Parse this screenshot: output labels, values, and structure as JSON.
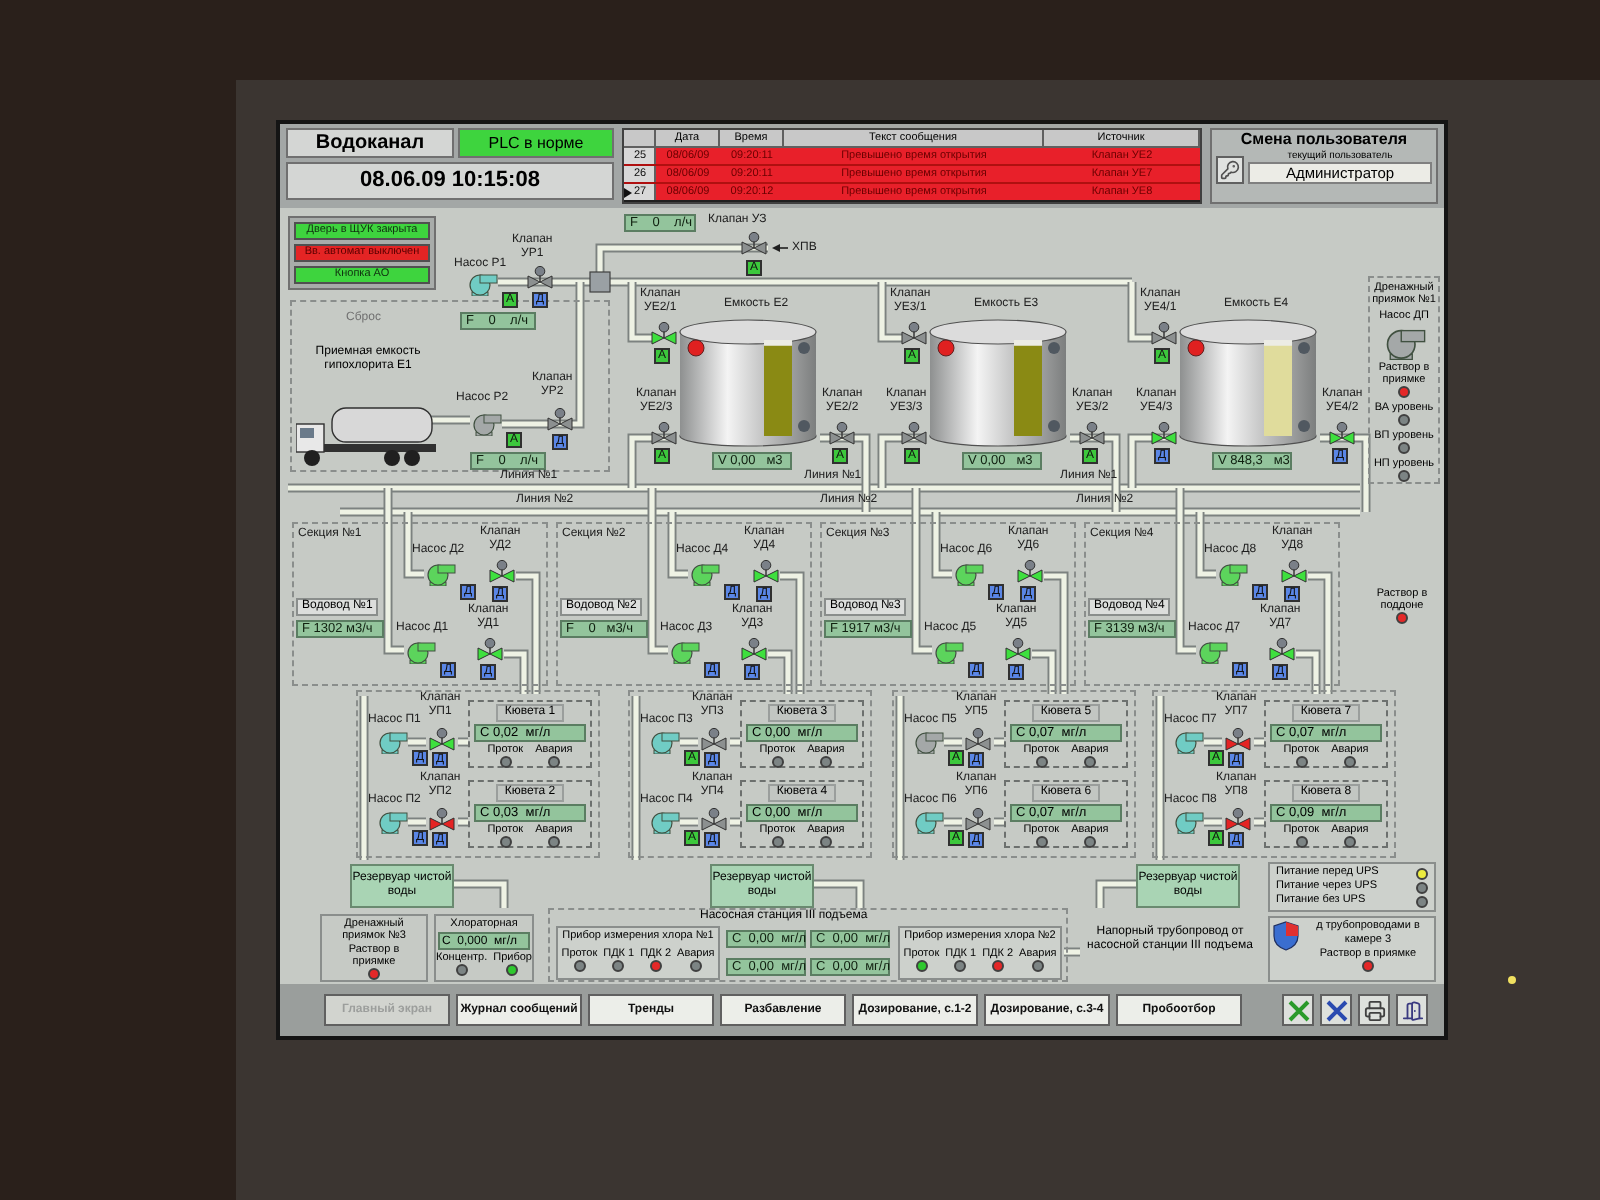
{
  "header": {
    "title": "Водоканал",
    "plc": {
      "text": "PLC в норме",
      "ok": true
    },
    "datetime": "08.06.09 10:15:08"
  },
  "alarms": {
    "columns": [
      "Дата",
      "Время",
      "Текст сообщения",
      "Источник"
    ],
    "rows": [
      {
        "num": "25",
        "date": "08/06/09",
        "time": "09:20:11",
        "text": "Превышено время открытия",
        "source": "Клапан УЕ2",
        "selected": false
      },
      {
        "num": "26",
        "date": "08/06/09",
        "time": "09:20:11",
        "text": "Превышено время открытия",
        "source": "Клапан УЕ7",
        "selected": false
      },
      {
        "num": "27",
        "date": "08/06/09",
        "time": "09:20:12",
        "text": "Превышено время открытия",
        "source": "Клапан УЕ8",
        "selected": true
      }
    ]
  },
  "user": {
    "title": "Смена пользователя",
    "caption": "текущий пользователь",
    "name": "Администратор"
  },
  "status_indicators": [
    {
      "text": "Дверь в ЩУК закрыта",
      "alarm": false
    },
    {
      "text": "Вв. автомат выключен",
      "alarm": true
    },
    {
      "text": "Кнопка АО",
      "alarm": false
    }
  ],
  "intake": {
    "reset": "Сброс",
    "tank_label": "Приемная емкость гипохлорита Е1",
    "supply_flow": "F    0    л/ч",
    "inlet": "ХПВ",
    "supply_valve": {
      "label": "Клапан",
      "tag": "УЗ",
      "color": "#8c9090",
      "badge": {
        "text": "А",
        "kind": "auto"
      }
    },
    "pumps": [
      {
        "label": "Насос Р1",
        "color": "#70ccc4",
        "badge": {
          "text": "А",
          "kind": "auto"
        },
        "flow": "F    0    л/ч"
      },
      {
        "label": "Насос Р2",
        "color": "#a4a8a8",
        "badge": {
          "text": "А",
          "kind": "auto"
        },
        "flow": "F    0    л/ч"
      }
    ],
    "valves": [
      {
        "label": "Клапан",
        "tag": "УР1",
        "color": "#8c9090",
        "badge": {
          "text": "Д",
          "kind": "remote"
        }
      },
      {
        "label": "Клапан",
        "tag": "УР2",
        "color": "#8c9090",
        "badge": {
          "text": "Д",
          "kind": "remote"
        }
      }
    ]
  },
  "tanks": [
    {
      "label": "Емкость Е2",
      "level": 0.94,
      "color": "#8a8a14",
      "volume": "V 0,00   м3",
      "valves": [
        {
          "label": "Клапан",
          "tag": "УЕ2/1",
          "color": "#3ee03e",
          "badge": {
            "text": "А",
            "kind": "auto"
          }
        },
        {
          "label": "Клапан",
          "tag": "УЕ2/3",
          "color": "#8c9090",
          "badge": {
            "text": "А",
            "kind": "auto"
          }
        },
        {
          "label": "Клапан",
          "tag": "УЕ2/2",
          "color": "#8c9090",
          "badge": {
            "text": "А",
            "kind": "auto"
          }
        }
      ]
    },
    {
      "label": "Емкость Е3",
      "level": 0.94,
      "color": "#8a8a14",
      "volume": "V 0,00   м3",
      "valves": [
        {
          "label": "Клапан",
          "tag": "УЕ3/1",
          "color": "#8c9090",
          "badge": {
            "text": "А",
            "kind": "auto"
          }
        },
        {
          "label": "Клапан",
          "tag": "УЕ3/3",
          "color": "#8c9090",
          "badge": {
            "text": "А",
            "kind": "auto"
          }
        },
        {
          "label": "Клапан",
          "tag": "УЕ3/2",
          "color": "#8c9090",
          "badge": {
            "text": "А",
            "kind": "auto"
          }
        }
      ]
    },
    {
      "label": "Емкость Е4",
      "level": 0.94,
      "color": "#e0dc9c",
      "volume": "V 848,3   м3",
      "valves": [
        {
          "label": "Клапан",
          "tag": "УЕ4/1",
          "color": "#8c9090",
          "badge": {
            "text": "А",
            "kind": "auto"
          }
        },
        {
          "label": "Клапан",
          "tag": "УЕ4/3",
          "color": "#3ee03e",
          "badge": {
            "text": "Д",
            "kind": "remote"
          }
        },
        {
          "label": "Клапан",
          "tag": "УЕ4/2",
          "color": "#3ee03e",
          "badge": {
            "text": "Д",
            "kind": "remote"
          }
        }
      ]
    }
  ],
  "lines": [
    {
      "text": "Линия №1"
    },
    {
      "text": "Линия №1"
    },
    {
      "text": "Линия №1"
    },
    {
      "text": "Линия №2"
    },
    {
      "text": "Линия №2"
    },
    {
      "text": "Линия №2"
    }
  ],
  "drain_1": {
    "title": "Дренажный приямок №1",
    "pump": {
      "label": "Насос ДП",
      "color": "#a4a8a8"
    },
    "indicators": [
      {
        "text": "Раствор в приямке",
        "color": "#e42828"
      },
      {
        "text": "ВА уровень",
        "color": "#7c8484"
      },
      {
        "text": "ВП уровень",
        "color": "#7c8484"
      },
      {
        "text": "НП уровень",
        "color": "#7c8484"
      }
    ]
  },
  "sections": [
    {
      "title": "Секция №1",
      "conduit": "Водовод №1",
      "flow": "F 1302 м3/ч",
      "pumps": [
        {
          "label": "Насос Д2",
          "color": "#5cd45c",
          "badge": {
            "text": "Д",
            "kind": "remote"
          }
        },
        {
          "label": "Насос Д1",
          "color": "#5cd45c",
          "badge": {
            "text": "Д",
            "kind": "remote"
          }
        }
      ],
      "valves": [
        {
          "label": "Клапан",
          "tag": "УД2",
          "color": "#3ee03e",
          "badge": {
            "text": "Д",
            "kind": "remote"
          }
        },
        {
          "label": "Клапан",
          "tag": "УД1",
          "color": "#3ee03e",
          "badge": {
            "text": "Д",
            "kind": "remote"
          }
        }
      ]
    },
    {
      "title": "Секция №2",
      "conduit": "Водовод №2",
      "flow": "F    0   м3/ч",
      "pumps": [
        {
          "label": "Насос Д4",
          "color": "#5cd45c",
          "badge": {
            "text": "Д",
            "kind": "remote"
          }
        },
        {
          "label": "Насос Д3",
          "color": "#5cd45c",
          "badge": {
            "text": "Д",
            "kind": "remote"
          }
        }
      ],
      "valves": [
        {
          "label": "Клапан",
          "tag": "УД4",
          "color": "#3ee03e",
          "badge": {
            "text": "Д",
            "kind": "remote"
          }
        },
        {
          "label": "Клапан",
          "tag": "УД3",
          "color": "#3ee03e",
          "badge": {
            "text": "Д",
            "kind": "remote"
          }
        }
      ]
    },
    {
      "title": "Секция №3",
      "conduit": "Водовод №3",
      "flow": "F 1917 м3/ч",
      "pumps": [
        {
          "label": "Насос Д6",
          "color": "#5cd45c",
          "badge": {
            "text": "Д",
            "kind": "remote"
          }
        },
        {
          "label": "Насос Д5",
          "color": "#5cd45c",
          "badge": {
            "text": "Д",
            "kind": "remote"
          }
        }
      ],
      "valves": [
        {
          "label": "Клапан",
          "tag": "УД6",
          "color": "#3ee03e",
          "badge": {
            "text": "Д",
            "kind": "remote"
          }
        },
        {
          "label": "Клапан",
          "tag": "УД5",
          "color": "#3ee03e",
          "badge": {
            "text": "Д",
            "kind": "remote"
          }
        }
      ]
    },
    {
      "title": "Секция №4",
      "conduit": "Водовод №4",
      "flow": "F 3139 м3/ч",
      "pumps": [
        {
          "label": "Насос Д8",
          "color": "#5cd45c",
          "badge": {
            "text": "Д",
            "kind": "remote"
          }
        },
        {
          "label": "Насос Д7",
          "color": "#5cd45c",
          "badge": {
            "text": "Д",
            "kind": "remote"
          }
        }
      ],
      "valves": [
        {
          "label": "Клапан",
          "tag": "УД8",
          "color": "#3ee03e",
          "badge": {
            "text": "Д",
            "kind": "remote"
          }
        },
        {
          "label": "Клапан",
          "tag": "УД7",
          "color": "#3ee03e",
          "badge": {
            "text": "Д",
            "kind": "remote"
          }
        }
      ]
    }
  ],
  "tray": {
    "text": "Раствор в поддоне",
    "color": "#e42828"
  },
  "chlorination": [
    {
      "pumps": [
        {
          "label": "Насос П1",
          "color": "#70ccc4",
          "badge": {
            "text": "Д",
            "kind": "remote"
          }
        },
        {
          "label": "Насос П2",
          "color": "#70ccc4",
          "badge": {
            "text": "Д",
            "kind": "remote"
          }
        }
      ],
      "valves": [
        {
          "label": "Клапан",
          "tag": "УП1",
          "color": "#3ee03e",
          "badge": {
            "text": "Д",
            "kind": "remote"
          }
        },
        {
          "label": "Клапан",
          "tag": "УП2",
          "color": "#e42424",
          "badge": {
            "text": "Д",
            "kind": "remote"
          }
        }
      ],
      "cuvettes": [
        {
          "title": "Кювета 1",
          "reading": "С 0,02  мг/л",
          "indicators": [
            {
              "text": "Проток",
              "color": "#7c8484"
            },
            {
              "text": "Авария",
              "color": "#7c8484"
            }
          ]
        },
        {
          "title": "Кювета 2",
          "reading": "С 0,03  мг/л",
          "indicators": [
            {
              "text": "Проток",
              "color": "#7c8484"
            },
            {
              "text": "Авария",
              "color": "#7c8484"
            }
          ]
        }
      ]
    },
    {
      "pumps": [
        {
          "label": "Насос П3",
          "color": "#70ccc4",
          "badge": {
            "text": "А",
            "kind": "auto"
          }
        },
        {
          "label": "Насос П4",
          "color": "#70ccc4",
          "badge": {
            "text": "А",
            "kind": "auto"
          }
        }
      ],
      "valves": [
        {
          "label": "Клапан",
          "tag": "УП3",
          "color": "#8c9090",
          "badge": {
            "text": "Д",
            "kind": "remote"
          }
        },
        {
          "label": "Клапан",
          "tag": "УП4",
          "color": "#8c9090",
          "badge": {
            "text": "Д",
            "kind": "remote"
          }
        }
      ],
      "cuvettes": [
        {
          "title": "Кювета 3",
          "reading": "С 0,00  мг/л",
          "indicators": [
            {
              "text": "Проток",
              "color": "#7c8484"
            },
            {
              "text": "Авария",
              "color": "#7c8484"
            }
          ]
        },
        {
          "title": "Кювета 4",
          "reading": "С 0,00  мг/л",
          "indicators": [
            {
              "text": "Проток",
              "color": "#7c8484"
            },
            {
              "text": "Авария",
              "color": "#7c8484"
            }
          ]
        }
      ]
    },
    {
      "pumps": [
        {
          "label": "Насос П5",
          "color": "#a4a8a8",
          "badge": {
            "text": "А",
            "kind": "auto"
          }
        },
        {
          "label": "Насос П6",
          "color": "#70ccc4",
          "badge": {
            "text": "А",
            "kind": "auto"
          }
        }
      ],
      "valves": [
        {
          "label": "Клапан",
          "tag": "УП5",
          "color": "#8c9090",
          "badge": {
            "text": "Д",
            "kind": "remote"
          }
        },
        {
          "label": "Клапан",
          "tag": "УП6",
          "color": "#8c9090",
          "badge": {
            "text": "Д",
            "kind": "remote"
          }
        }
      ],
      "cuvettes": [
        {
          "title": "Кювета 5",
          "reading": "С 0,07  мг/л",
          "indicators": [
            {
              "text": "Проток",
              "color": "#7c8484"
            },
            {
              "text": "Авария",
              "color": "#7c8484"
            }
          ]
        },
        {
          "title": "Кювета 6",
          "reading": "С 0,07  мг/л",
          "indicators": [
            {
              "text": "Проток",
              "color": "#7c8484"
            },
            {
              "text": "Авария",
              "color": "#7c8484"
            }
          ]
        }
      ]
    },
    {
      "pumps": [
        {
          "label": "Насос П7",
          "color": "#70ccc4",
          "badge": {
            "text": "А",
            "kind": "auto"
          }
        },
        {
          "label": "Насос П8",
          "color": "#70ccc4",
          "badge": {
            "text": "А",
            "kind": "auto"
          }
        }
      ],
      "valves": [
        {
          "label": "Клапан",
          "tag": "УП7",
          "color": "#e42424",
          "badge": {
            "text": "Д",
            "kind": "remote"
          }
        },
        {
          "label": "Клапан",
          "tag": "УП8",
          "color": "#e42424",
          "badge": {
            "text": "Д",
            "kind": "remote"
          }
        }
      ],
      "cuvettes": [
        {
          "title": "Кювета 7",
          "reading": "С 0,07  мг/л",
          "indicators": [
            {
              "text": "Проток",
              "color": "#7c8484"
            },
            {
              "text": "Авария",
              "color": "#7c8484"
            }
          ]
        },
        {
          "title": "Кювета 8",
          "reading": "С 0,09  мг/л",
          "indicators": [
            {
              "text": "Проток",
              "color": "#7c8484"
            },
            {
              "text": "Авария",
              "color": "#7c8484"
            }
          ]
        }
      ]
    }
  ],
  "reservoirs": [
    {
      "text": "Резервуар чистой воды"
    },
    {
      "text": "Резервуар чистой воды"
    },
    {
      "text": "Резервуар чистой воды"
    }
  ],
  "drain_3": {
    "title": "Дренажный приямок №3",
    "indicator": {
      "text": "Раствор в приямке",
      "color": "#e42828"
    }
  },
  "chlorinator_room": {
    "title": "Хлораторная",
    "reading": "С  0,000  мг/л",
    "indicators": [
      {
        "text": "Концентр.",
        "color": "#7c8484"
      },
      {
        "text": "Прибор",
        "color": "#2ec82e"
      }
    ]
  },
  "pump_station": {
    "title": "Насосная станция III подъема",
    "readings": [
      "С  0,00  мг/л",
      "С  0,00  мг/л",
      "С  0,00  мг/л",
      "С  0,00  мг/л"
    ],
    "meters": [
      {
        "title": "Прибор измерения хлора №1",
        "indicators": [
          {
            "text": "Проток",
            "color": "#7c8484"
          },
          {
            "text": "ПДК 1",
            "color": "#7c8484"
          },
          {
            "text": "ПДК 2",
            "color": "#e42828"
          },
          {
            "text": "Авария",
            "color": "#7c8484"
          }
        ]
      },
      {
        "title": "Прибор измерения хлора №2",
        "indicators": [
          {
            "text": "Проток",
            "color": "#2ec82e"
          },
          {
            "text": "ПДК 1",
            "color": "#7c8484"
          },
          {
            "text": "ПДК 2",
            "color": "#e42828"
          },
          {
            "text": "Авария",
            "color": "#7c8484"
          }
        ]
      }
    ]
  },
  "pressure_pipe": "Напорный трубопровод от насосной станции III подъема",
  "ups": [
    {
      "text": "Питание перед UPS",
      "color": "#ecec40"
    },
    {
      "text": "Питание через UPS",
      "color": "#7c8484"
    },
    {
      "text": "Питание без UPS",
      "color": "#7c8484"
    }
  ],
  "drain_chamber": {
    "title": "д трубопроводами в камере 3",
    "indicator": {
      "text": "Раствор в приямке",
      "color": "#e42828"
    }
  },
  "nav": [
    {
      "label": "Главный экран",
      "selected": true
    },
    {
      "label": "Журнал сообщений",
      "selected": false
    },
    {
      "label": "Тренды",
      "selected": false
    },
    {
      "label": "Разбавление",
      "selected": false
    },
    {
      "label": "Дозирование, с.1-2",
      "selected": false
    },
    {
      "label": "Дозирование, с.3-4",
      "selected": false
    },
    {
      "label": "Пробоотбор",
      "selected": false
    }
  ]
}
